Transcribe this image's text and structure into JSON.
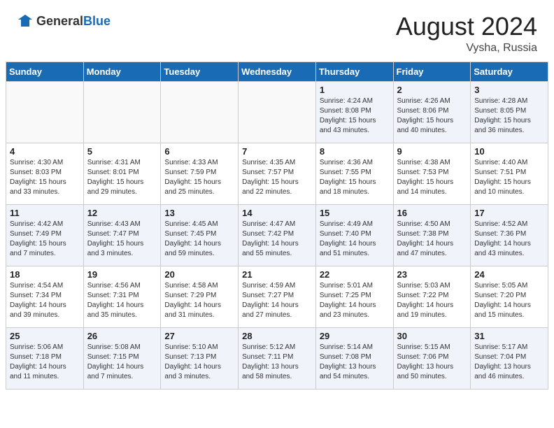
{
  "header": {
    "logo_general": "General",
    "logo_blue": "Blue",
    "month_year": "August 2024",
    "location": "Vysha, Russia"
  },
  "days_of_week": [
    "Sunday",
    "Monday",
    "Tuesday",
    "Wednesday",
    "Thursday",
    "Friday",
    "Saturday"
  ],
  "weeks": [
    [
      {
        "day": "",
        "info": ""
      },
      {
        "day": "",
        "info": ""
      },
      {
        "day": "",
        "info": ""
      },
      {
        "day": "",
        "info": ""
      },
      {
        "day": "1",
        "info": "Sunrise: 4:24 AM\nSunset: 8:08 PM\nDaylight: 15 hours\nand 43 minutes."
      },
      {
        "day": "2",
        "info": "Sunrise: 4:26 AM\nSunset: 8:06 PM\nDaylight: 15 hours\nand 40 minutes."
      },
      {
        "day": "3",
        "info": "Sunrise: 4:28 AM\nSunset: 8:05 PM\nDaylight: 15 hours\nand 36 minutes."
      }
    ],
    [
      {
        "day": "4",
        "info": "Sunrise: 4:30 AM\nSunset: 8:03 PM\nDaylight: 15 hours\nand 33 minutes."
      },
      {
        "day": "5",
        "info": "Sunrise: 4:31 AM\nSunset: 8:01 PM\nDaylight: 15 hours\nand 29 minutes."
      },
      {
        "day": "6",
        "info": "Sunrise: 4:33 AM\nSunset: 7:59 PM\nDaylight: 15 hours\nand 25 minutes."
      },
      {
        "day": "7",
        "info": "Sunrise: 4:35 AM\nSunset: 7:57 PM\nDaylight: 15 hours\nand 22 minutes."
      },
      {
        "day": "8",
        "info": "Sunrise: 4:36 AM\nSunset: 7:55 PM\nDaylight: 15 hours\nand 18 minutes."
      },
      {
        "day": "9",
        "info": "Sunrise: 4:38 AM\nSunset: 7:53 PM\nDaylight: 15 hours\nand 14 minutes."
      },
      {
        "day": "10",
        "info": "Sunrise: 4:40 AM\nSunset: 7:51 PM\nDaylight: 15 hours\nand 10 minutes."
      }
    ],
    [
      {
        "day": "11",
        "info": "Sunrise: 4:42 AM\nSunset: 7:49 PM\nDaylight: 15 hours\nand 7 minutes."
      },
      {
        "day": "12",
        "info": "Sunrise: 4:43 AM\nSunset: 7:47 PM\nDaylight: 15 hours\nand 3 minutes."
      },
      {
        "day": "13",
        "info": "Sunrise: 4:45 AM\nSunset: 7:45 PM\nDaylight: 14 hours\nand 59 minutes."
      },
      {
        "day": "14",
        "info": "Sunrise: 4:47 AM\nSunset: 7:42 PM\nDaylight: 14 hours\nand 55 minutes."
      },
      {
        "day": "15",
        "info": "Sunrise: 4:49 AM\nSunset: 7:40 PM\nDaylight: 14 hours\nand 51 minutes."
      },
      {
        "day": "16",
        "info": "Sunrise: 4:50 AM\nSunset: 7:38 PM\nDaylight: 14 hours\nand 47 minutes."
      },
      {
        "day": "17",
        "info": "Sunrise: 4:52 AM\nSunset: 7:36 PM\nDaylight: 14 hours\nand 43 minutes."
      }
    ],
    [
      {
        "day": "18",
        "info": "Sunrise: 4:54 AM\nSunset: 7:34 PM\nDaylight: 14 hours\nand 39 minutes."
      },
      {
        "day": "19",
        "info": "Sunrise: 4:56 AM\nSunset: 7:31 PM\nDaylight: 14 hours\nand 35 minutes."
      },
      {
        "day": "20",
        "info": "Sunrise: 4:58 AM\nSunset: 7:29 PM\nDaylight: 14 hours\nand 31 minutes."
      },
      {
        "day": "21",
        "info": "Sunrise: 4:59 AM\nSunset: 7:27 PM\nDaylight: 14 hours\nand 27 minutes."
      },
      {
        "day": "22",
        "info": "Sunrise: 5:01 AM\nSunset: 7:25 PM\nDaylight: 14 hours\nand 23 minutes."
      },
      {
        "day": "23",
        "info": "Sunrise: 5:03 AM\nSunset: 7:22 PM\nDaylight: 14 hours\nand 19 minutes."
      },
      {
        "day": "24",
        "info": "Sunrise: 5:05 AM\nSunset: 7:20 PM\nDaylight: 14 hours\nand 15 minutes."
      }
    ],
    [
      {
        "day": "25",
        "info": "Sunrise: 5:06 AM\nSunset: 7:18 PM\nDaylight: 14 hours\nand 11 minutes."
      },
      {
        "day": "26",
        "info": "Sunrise: 5:08 AM\nSunset: 7:15 PM\nDaylight: 14 hours\nand 7 minutes."
      },
      {
        "day": "27",
        "info": "Sunrise: 5:10 AM\nSunset: 7:13 PM\nDaylight: 14 hours\nand 3 minutes."
      },
      {
        "day": "28",
        "info": "Sunrise: 5:12 AM\nSunset: 7:11 PM\nDaylight: 13 hours\nand 58 minutes."
      },
      {
        "day": "29",
        "info": "Sunrise: 5:14 AM\nSunset: 7:08 PM\nDaylight: 13 hours\nand 54 minutes."
      },
      {
        "day": "30",
        "info": "Sunrise: 5:15 AM\nSunset: 7:06 PM\nDaylight: 13 hours\nand 50 minutes."
      },
      {
        "day": "31",
        "info": "Sunrise: 5:17 AM\nSunset: 7:04 PM\nDaylight: 13 hours\nand 46 minutes."
      }
    ]
  ]
}
